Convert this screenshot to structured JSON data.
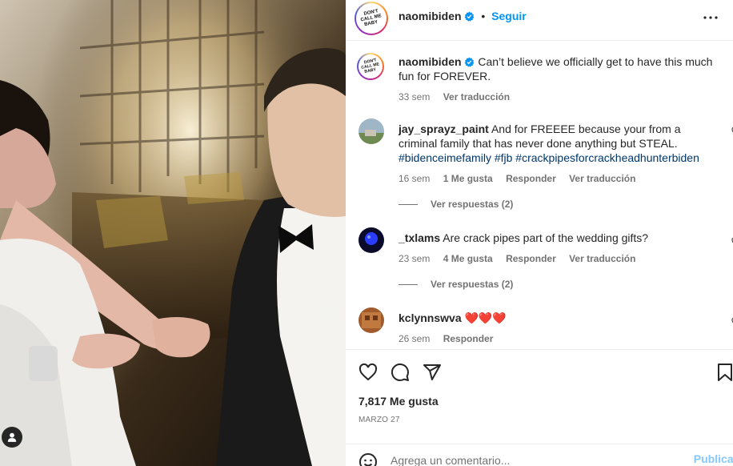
{
  "post": {
    "author": "naomibiden",
    "follow_label": "Seguir",
    "dot": "•",
    "caption_author": "naomibiden",
    "caption_text": "Can’t believe we officially get to have this much fun for FOREVER.",
    "caption_time": "33 sem",
    "caption_translate": "Ver traducción"
  },
  "comments": [
    {
      "user": "jay_sprayz_paint",
      "text": "And for FREEEE because your from a criminal family that has never done anything but STEAL.",
      "hashtags": "#bidenceimefamily #fjb #crackpipesforcrackheadhunterbiden",
      "time": "16 sem",
      "likes": "1 Me gusta",
      "reply": "Responder",
      "translate": "Ver traducción",
      "replies": "Ver respuestas (2)"
    },
    {
      "user": "_txlams",
      "text": "Are crack pipes part of the wedding gifts?",
      "time": "23 sem",
      "likes": "4 Me gusta",
      "reply": "Responder",
      "translate": "Ver traducción",
      "replies": "Ver respuestas (2)"
    },
    {
      "user": "kclynnswva",
      "text": "❤️❤️❤️",
      "time": "26 sem",
      "reply": "Responder"
    }
  ],
  "footer": {
    "likes": "7,817 Me gusta",
    "date": "MARZO 27",
    "comment_placeholder": "Agrega un comentario...",
    "publish_label": "Publicar"
  },
  "icons": {
    "like": "heart-icon",
    "comment": "comment-icon",
    "share": "paper-plane-icon",
    "save": "bookmark-icon",
    "more": "more-horizontal-icon",
    "emoji": "emoji-icon",
    "tagged": "user-tag-icon"
  },
  "colors": {
    "link": "#0095f6",
    "hashtag": "#00376b",
    "muted": "#737373",
    "heart": "#ed4956"
  }
}
